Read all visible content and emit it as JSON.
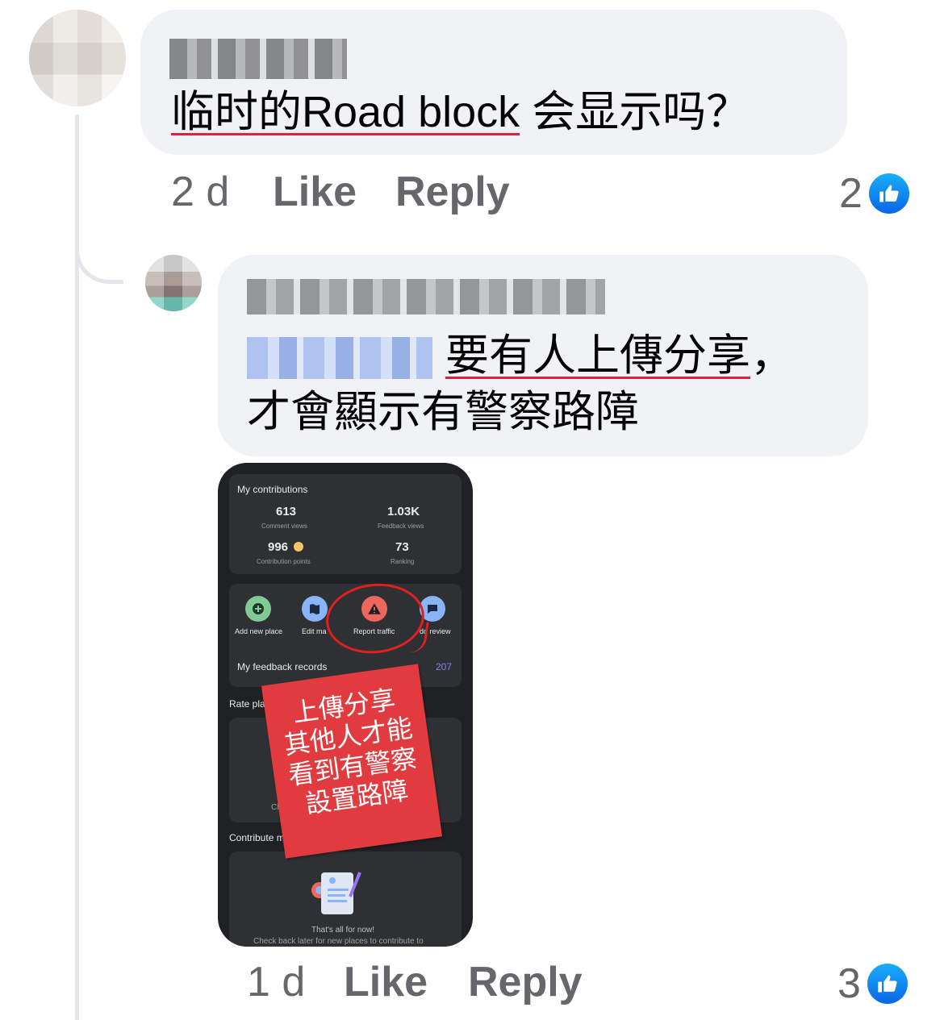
{
  "comment1": {
    "text_underlined": "临时的Road block",
    "text_rest": " 会显示吗？",
    "time": "2 d",
    "like_label": "Like",
    "reply_label": "Reply",
    "reaction_count": "2"
  },
  "comment2": {
    "text_line1_underlined": "要有人上傳分享",
    "text_line1_rest": "，",
    "text_line2": "才會顯示有警察路障",
    "time": "1 d",
    "like_label": "Like",
    "reply_label": "Reply",
    "reaction_count": "3"
  },
  "attachment": {
    "contributions_title": "My contributions",
    "stats": [
      {
        "value": "613",
        "label": "Comment views"
      },
      {
        "value": "1.03K",
        "label": "Feedback views"
      },
      {
        "value": "996",
        "label": "Contribution points"
      },
      {
        "value": "73",
        "label": "Ranking"
      }
    ],
    "actions": [
      {
        "label": "Add new place",
        "icon": "add-place-icon",
        "color": "#81c995"
      },
      {
        "label": "Edit ma",
        "icon": "edit-map-icon",
        "color": "#8ab4f8"
      },
      {
        "label": "Report traffic",
        "icon": "warning-icon",
        "color": "#ee675c"
      },
      {
        "label": "dd review",
        "icon": "review-icon",
        "color": "#8ab4f8"
      }
    ],
    "feedback_label": "My feedback records",
    "feedback_count": "207",
    "rate_label": "Rate plac",
    "check_label": "Che",
    "contribute_label": "Contribute m",
    "empty_title": "That's all for now!",
    "empty_sub": "Check back later for new places to contribute to",
    "sticker_lines": [
      "上傳分享",
      "其他人才能",
      "看到有警察",
      "設置路障"
    ]
  },
  "colors": {
    "bubble": "#f0f2f5",
    "meta_text": "#65676b",
    "underline": "#e41e3f",
    "like_blue": "#0a66e4",
    "sticker_red": "#e23b3f"
  }
}
